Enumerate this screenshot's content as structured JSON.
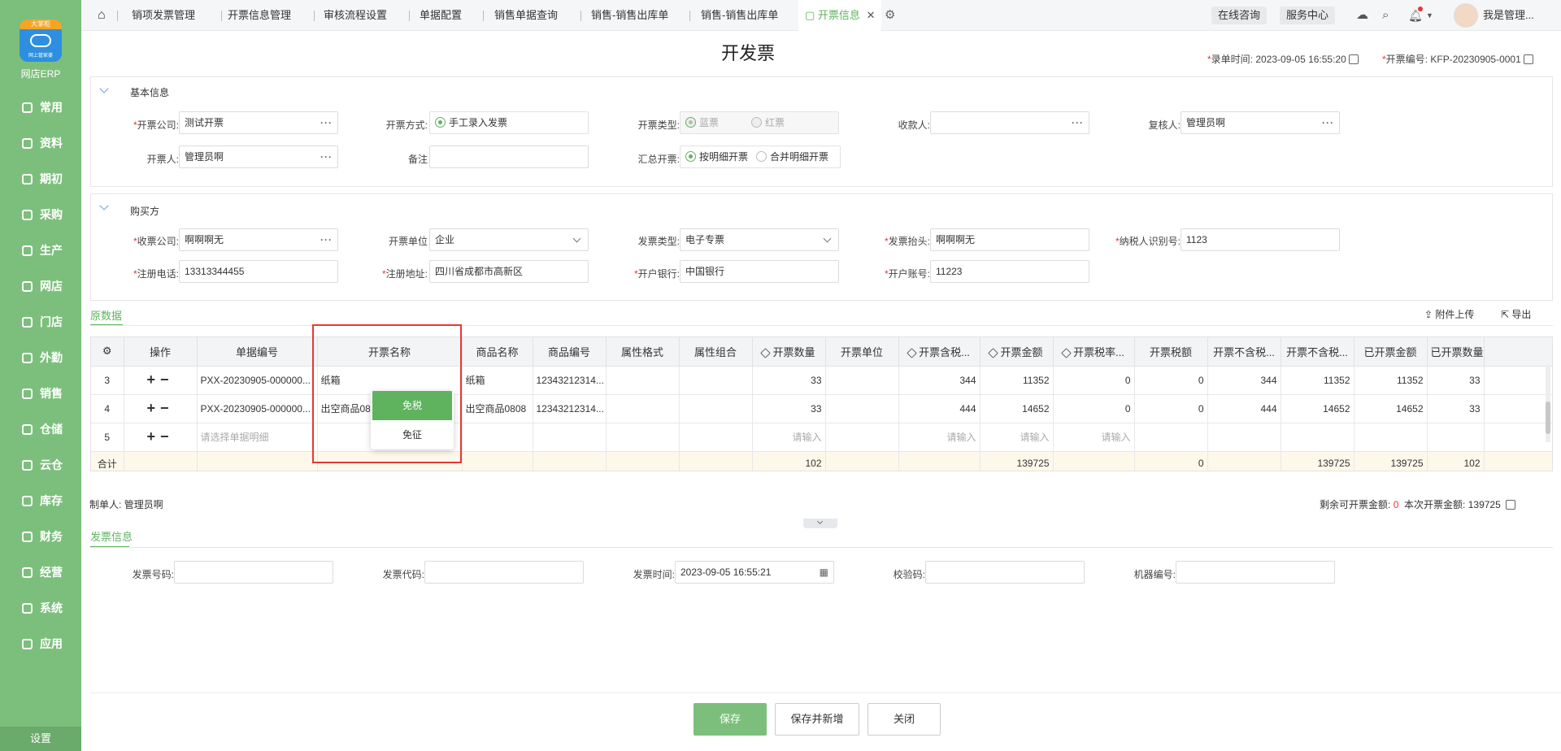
{
  "sidebar": {
    "brand": "网店ERP",
    "logo_badge": "大掌柜",
    "logo_sub": "网上管家婆",
    "items": [
      {
        "label": "常用",
        "icon": "star-icon"
      },
      {
        "label": "资料",
        "icon": "document-icon"
      },
      {
        "label": "期初",
        "icon": "clock-icon"
      },
      {
        "label": "采购",
        "icon": "cart-icon"
      },
      {
        "label": "生产",
        "icon": "factory-icon"
      },
      {
        "label": "网店",
        "icon": "shop-icon"
      },
      {
        "label": "门店",
        "icon": "pie-icon"
      },
      {
        "label": "外勤",
        "icon": "gear-icon"
      },
      {
        "label": "销售",
        "icon": "chart-icon"
      },
      {
        "label": "仓储",
        "icon": "warehouse-icon"
      },
      {
        "label": "云仓",
        "icon": "cloud-icon"
      },
      {
        "label": "库存",
        "icon": "box-icon"
      },
      {
        "label": "财务",
        "icon": "finance-icon"
      },
      {
        "label": "经营",
        "icon": "business-icon"
      },
      {
        "label": "系统",
        "icon": "settings-icon"
      },
      {
        "label": "应用",
        "icon": "plus-icon"
      }
    ],
    "settings": "设置"
  },
  "tabs": [
    "销项发票管理",
    "开票信息管理",
    "审核流程设置",
    "单据配置",
    "销售单据查询",
    "销售-销售出库单",
    "销售-销售出库单",
    "开票信息"
  ],
  "header": {
    "consult": "在线咨询",
    "service": "服务中心",
    "user": "我是管理..."
  },
  "page": {
    "title": "开发票",
    "entry_time_label": "录单时间:",
    "entry_time": "2023-09-05 16:55:20",
    "invoice_no_label": "开票编号:",
    "invoice_no": "KFP-20230905-0001"
  },
  "basic": {
    "title": "基本信息",
    "company_label": "开票公司:",
    "company": "测试开票",
    "method_label": "开票方式:",
    "method": "手工录入发票",
    "type_label": "开票类型:",
    "type_blue": "蓝票",
    "type_red": "红票",
    "payee_label": "收款人:",
    "payee": "",
    "reviewer_label": "复核人:",
    "reviewer": "管理员啊",
    "drawer_label": "开票人:",
    "drawer": "管理员啊",
    "remark_label": "备注",
    "remark": "",
    "summary_label": "汇总开票:",
    "summary_detail": "按明细开票",
    "summary_merge": "合并明细开票"
  },
  "buyer": {
    "title": "购买方",
    "company_label": "收票公司:",
    "company": "啊啊啊无",
    "unit_label": "开票单位",
    "unit": "企业",
    "invtype_label": "发票类型:",
    "invtype": "电子专票",
    "header_label": "发票抬头:",
    "header": "啊啊啊无",
    "taxid_label": "纳税人识别号:",
    "taxid": "1123",
    "phone_label": "注册电话:",
    "phone": "13313344455",
    "addr_label": "注册地址:",
    "addr": "四川省成都市高新区",
    "bank_label": "开户银行:",
    "bank": "中国银行",
    "account_label": "开户账号:",
    "account": "11223"
  },
  "grid": {
    "tab": "原数据",
    "upload": "附件上传",
    "export": "导出",
    "columns": [
      "操作",
      "单据编号",
      "开票名称",
      "商品名称",
      "商品编号",
      "属性格式",
      "属性组合",
      "开票数量",
      "开票单位",
      "开票含税...",
      "开票金额",
      "开票税率...",
      "开票税额",
      "开票不含税...",
      "开票不含税...",
      "已开票金额",
      "已开票数量"
    ],
    "rows": [
      [
        "3",
        "PXX-20230905-000000...",
        "纸箱",
        "纸箱",
        "12343212314...",
        "",
        "",
        "33",
        "",
        "344",
        "11352",
        "0",
        "0",
        "344",
        "11352",
        "11352",
        "33"
      ],
      [
        "4",
        "PXX-20230905-000000...",
        "出空商品08",
        "出空商品0808",
        "12343212314...",
        "",
        "",
        "33",
        "",
        "444",
        "14652",
        "0",
        "0",
        "444",
        "14652",
        "14652",
        "33"
      ]
    ],
    "new_row": {
      "no": "5",
      "placeholder": "请选择单据明细",
      "input": "请输入"
    },
    "sum": {
      "label": "合计",
      "qty": "102",
      "amount": "139725",
      "tax": "0",
      "notax": "139725",
      "invoiced_amt": "139725",
      "invoiced_qty": "102"
    },
    "popup": [
      "免税",
      "免征"
    ]
  },
  "footer": {
    "maker_label": "制单人:",
    "maker": "管理员啊",
    "remain_label": "剩余可开票金额:",
    "remain": "0",
    "this_label": "本次开票金额:",
    "this": "139725"
  },
  "invoice": {
    "tab": "发票信息",
    "no_label": "发票号码:",
    "code_label": "发票代码:",
    "time_label": "发票时间:",
    "time": "2023-09-05 16:55:21",
    "check_label": "校验码:",
    "machine_label": "机器编号:"
  },
  "buttons": {
    "save": "保存",
    "save_new": "保存并新增",
    "close": "关闭"
  }
}
